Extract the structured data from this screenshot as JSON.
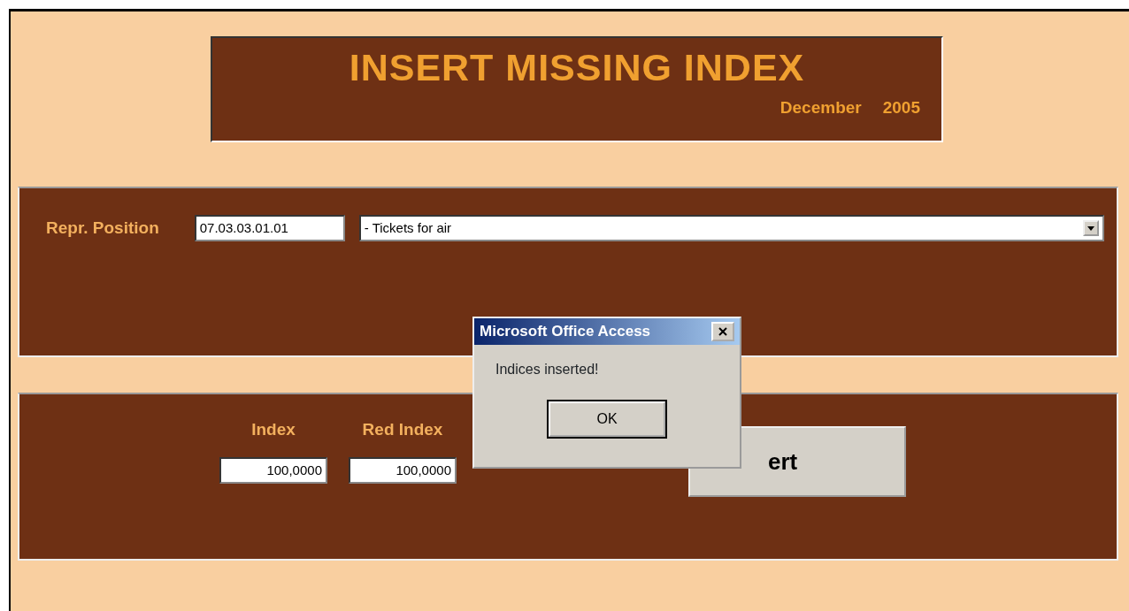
{
  "header": {
    "title": "INSERT MISSING INDEX",
    "month": "December",
    "year": "2005"
  },
  "position": {
    "label": "Repr. Position",
    "code": "07.03.03.01.01",
    "description": "- Tickets for air"
  },
  "indices": [
    {
      "label": "Index",
      "value": "100,0000"
    },
    {
      "label": "Red Index",
      "value": "100,0000"
    }
  ],
  "insert_button": {
    "label": "ert"
  },
  "dialog": {
    "title": "Microsoft Office Access",
    "message": "Indices inserted!",
    "button": "OK"
  }
}
